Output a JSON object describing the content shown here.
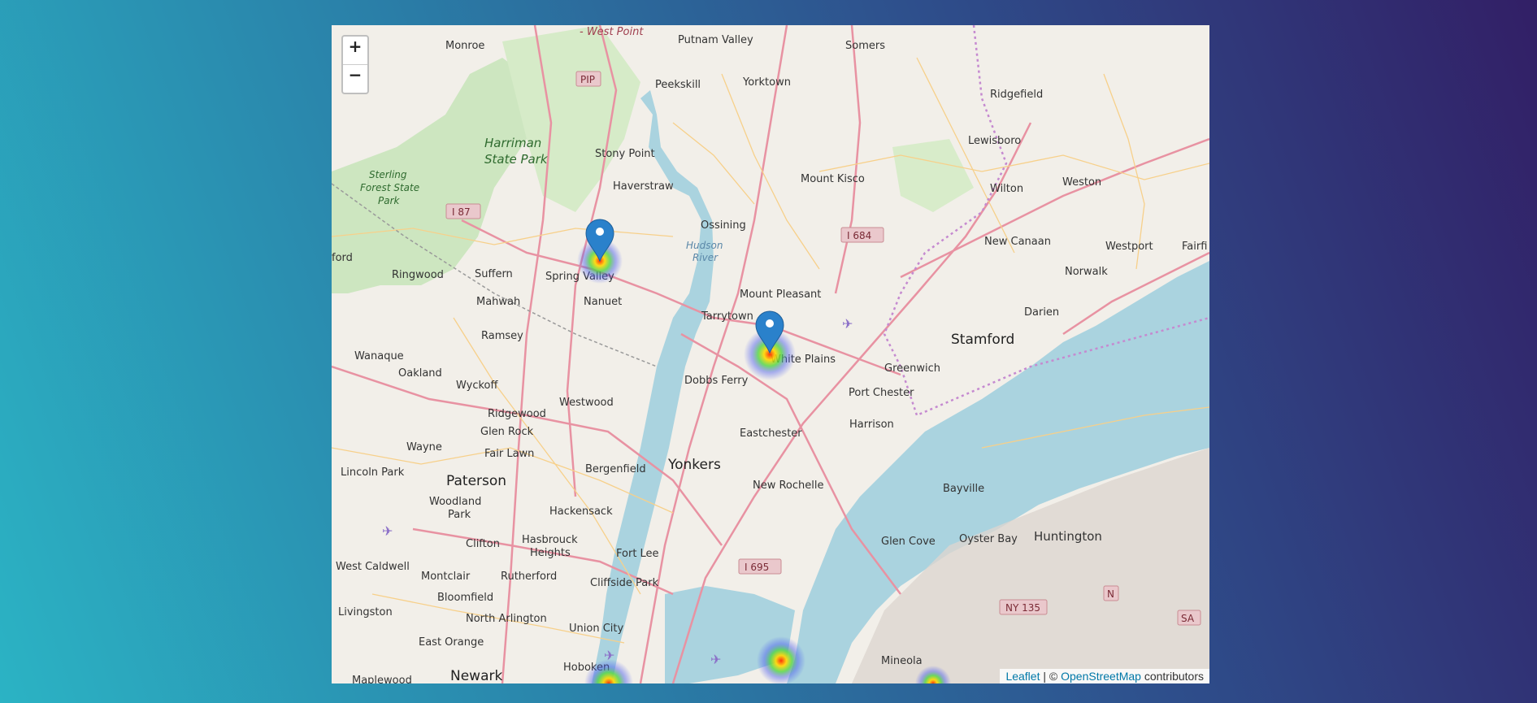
{
  "zoom": {
    "in_label": "+",
    "out_label": "−"
  },
  "attribution": {
    "leaflet": "Leaflet",
    "sep": " | © ",
    "osm": "OpenStreetMap",
    "suffix": " contributors"
  },
  "places": {
    "west_point": "- West Point",
    "putnam_valley": "Putnam Valley",
    "somers": "Somers",
    "monroe": "Monroe",
    "peekskill": "Peekskill",
    "yorktown": "Yorktown",
    "ridgefield": "Ridgefield",
    "harriman": "Harriman",
    "state_park": "State Park",
    "stony_point": "Stony Point",
    "lewisboro": "Lewisboro",
    "sterling": "Sterling",
    "forest_state": "Forest State",
    "park": "Park",
    "mount_kisco": "Mount Kisco",
    "haverstraw": "Haverstraw",
    "wilton": "Wilton",
    "weston": "Weston",
    "ossining": "Ossining",
    "new_canaan": "New Canaan",
    "westport": "Westport",
    "fairfi": "Fairfi",
    "hudson": "Hudson",
    "river": "River",
    "ford": "ford",
    "ringwood": "Ringwood",
    "suffern": "Suffern",
    "spring_valley": "Spring Valley",
    "norwalk": "Norwalk",
    "mahwah": "Mahwah",
    "nanuet": "Nanuet",
    "mount_pleasant": "Mount Pleasant",
    "darien": "Darien",
    "tarrytown": "Tarrytown",
    "stamford": "Stamford",
    "ramsey": "Ramsey",
    "white_plains": "White Plains",
    "wanaque": "Wanaque",
    "greenwich": "Greenwich",
    "oakland": "Oakland",
    "dobbs_ferry": "Dobbs Ferry",
    "wyckoff": "Wyckoff",
    "port_chester": "Port Chester",
    "westwood": "Westwood",
    "ridgewood": "Ridgewood",
    "harrison": "Harrison",
    "glen_rock": "Glen Rock",
    "eastchester": "Eastchester",
    "wayne": "Wayne",
    "fair_lawn": "Fair Lawn",
    "yonkers": "Yonkers",
    "bergenfield": "Bergenfield",
    "lincoln_park": "Lincoln Park",
    "paterson": "Paterson",
    "new_rochelle": "New Rochelle",
    "bayville": "Bayville",
    "woodland": "Woodland",
    "park2": "Park",
    "hackensack": "Hackensack",
    "clifton": "Clifton",
    "hasbrouck": "Hasbrouck",
    "heights": "Heights",
    "glen_cove": "Glen Cove",
    "oyster_bay": "Oyster Bay",
    "huntington": "Huntington",
    "west_caldwell": "West Caldwell",
    "fort_lee": "Fort Lee",
    "montclair": "Montclair",
    "rutherford": "Rutherford",
    "bloomfield": "Bloomfield",
    "cliffside_park": "Cliffside Park",
    "livingston": "Livingston",
    "north_arlington": "North Arlington",
    "union_city": "Union City",
    "east_orange": "East Orange",
    "hoboken": "Hoboken",
    "mineola": "Mineola",
    "maplewood": "Maplewood",
    "newark": "Newark"
  },
  "shields": {
    "pip": "PIP",
    "i87": "I 87",
    "i684": "I 684",
    "i695": "I 695",
    "ny135": "NY 135",
    "n": "N",
    "sa": "SA"
  },
  "colors": {
    "land": "#f2efe9",
    "water": "#aad3df",
    "park": "#cde6c0",
    "road_major": "#e892a2",
    "road_minor": "#f7d08a",
    "marker": "#2a81cb"
  },
  "markers": [
    {
      "icon": "map-marker-icon"
    },
    {
      "icon": "map-marker-icon"
    }
  ],
  "heat_spots": [
    {
      "icon": "heatmap-spot-icon"
    }
  ]
}
